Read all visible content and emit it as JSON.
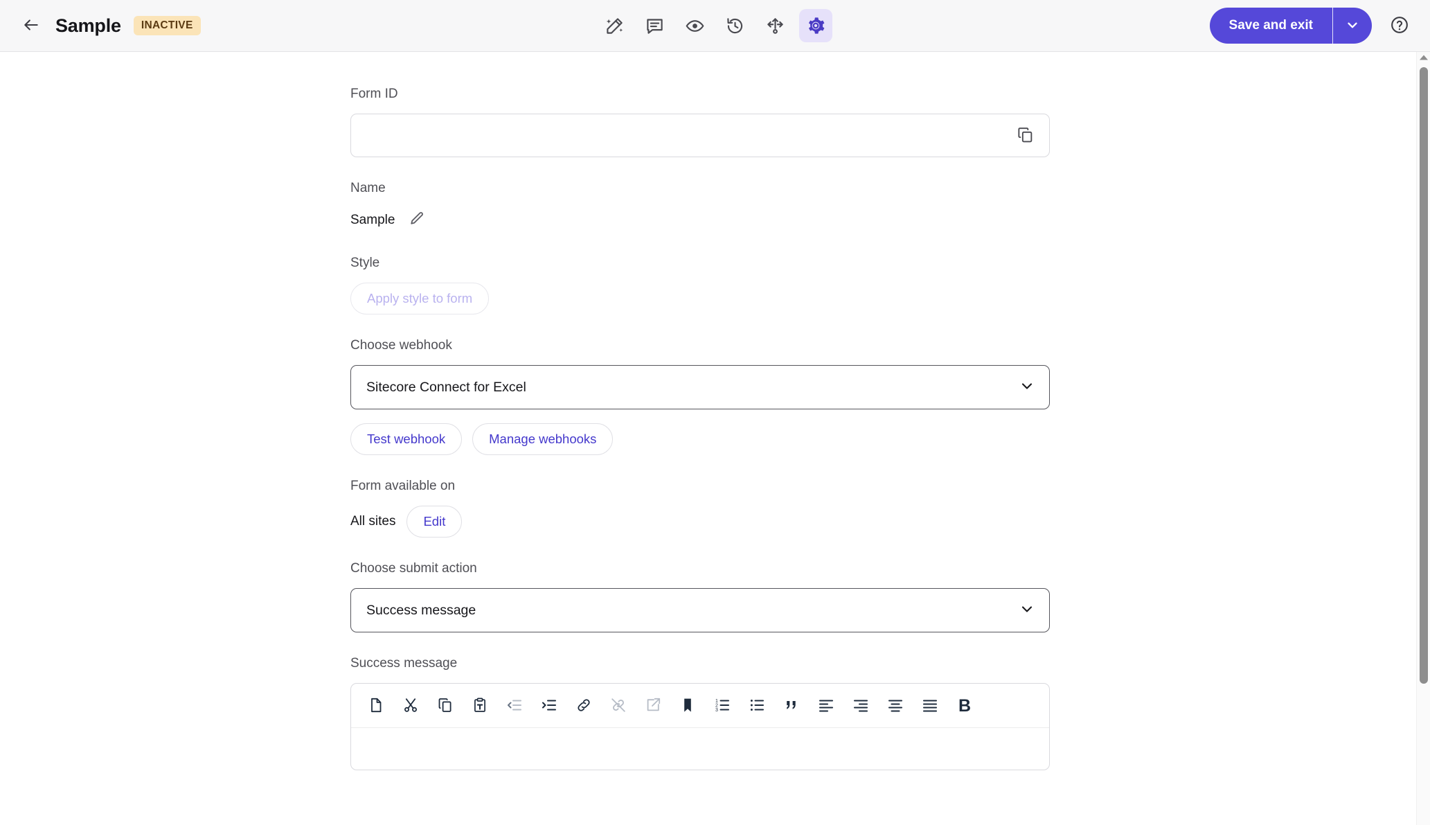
{
  "header": {
    "back_icon": "arrow-left-icon",
    "title": "Sample",
    "status": "INACTIVE",
    "tools": [
      {
        "name": "design-icon",
        "label": "Design"
      },
      {
        "name": "comments-icon",
        "label": "Comments"
      },
      {
        "name": "preview-icon",
        "label": "Preview"
      },
      {
        "name": "history-icon",
        "label": "Version history"
      },
      {
        "name": "move-icon",
        "label": "Move"
      },
      {
        "name": "settings-gear-icon",
        "label": "Settings"
      }
    ],
    "save_label": "Save and exit",
    "save_caret_icon": "chevron-down-icon",
    "help_icon": "help-circle-icon",
    "accent_color": "#5548d9",
    "active_tool_bg": "#e6e1fa",
    "badge_bg": "#fbe4b8",
    "badge_color": "#5a3a12"
  },
  "form": {
    "form_id": {
      "label": "Form ID",
      "value": "",
      "placeholder": "",
      "copy_icon": "copy-icon"
    },
    "name": {
      "label": "Name",
      "value": "Sample",
      "edit_icon": "pencil-icon"
    },
    "style": {
      "label": "Style",
      "apply_label": "Apply style to form",
      "disabled": true
    },
    "webhook": {
      "label": "Choose webhook",
      "selected": "Sitecore Connect for Excel",
      "chevron_icon": "chevron-down-icon",
      "test_label": "Test webhook",
      "manage_label": "Manage webhooks"
    },
    "available_on": {
      "label": "Form available on",
      "value": "All sites",
      "edit_label": "Edit"
    },
    "submit_action": {
      "label": "Choose submit action",
      "selected": "Success message",
      "chevron_icon": "chevron-down-icon"
    },
    "success_message": {
      "label": "Success message",
      "toolbar": [
        {
          "name": "new-document-icon",
          "label": "New document"
        },
        {
          "name": "cut-icon",
          "label": "Cut"
        },
        {
          "name": "copy-icon",
          "label": "Copy"
        },
        {
          "name": "paste-text-icon",
          "label": "Paste as plain text"
        },
        {
          "name": "outdent-icon",
          "label": "Decrease indent"
        },
        {
          "name": "indent-icon",
          "label": "Increase indent"
        },
        {
          "name": "link-icon",
          "label": "Link"
        },
        {
          "name": "unlink-icon",
          "label": "Unlink"
        },
        {
          "name": "external-link-icon",
          "label": "Open link in new window"
        },
        {
          "name": "anchor-bookmark-icon",
          "label": "Anchor"
        },
        {
          "name": "numbered-list-icon",
          "label": "Numbered list"
        },
        {
          "name": "bullet-list-icon",
          "label": "Bulleted list"
        },
        {
          "name": "blockquote-icon",
          "label": "Block quote"
        },
        {
          "name": "align-left-icon",
          "label": "Align left"
        },
        {
          "name": "align-right-icon",
          "label": "Align right"
        },
        {
          "name": "align-center-icon",
          "label": "Align center"
        },
        {
          "name": "justify-icon",
          "label": "Justify"
        },
        {
          "name": "bold-icon",
          "label": "B"
        }
      ],
      "content": ""
    }
  },
  "scrollbar": {
    "up_icon": "caret-up-icon"
  }
}
